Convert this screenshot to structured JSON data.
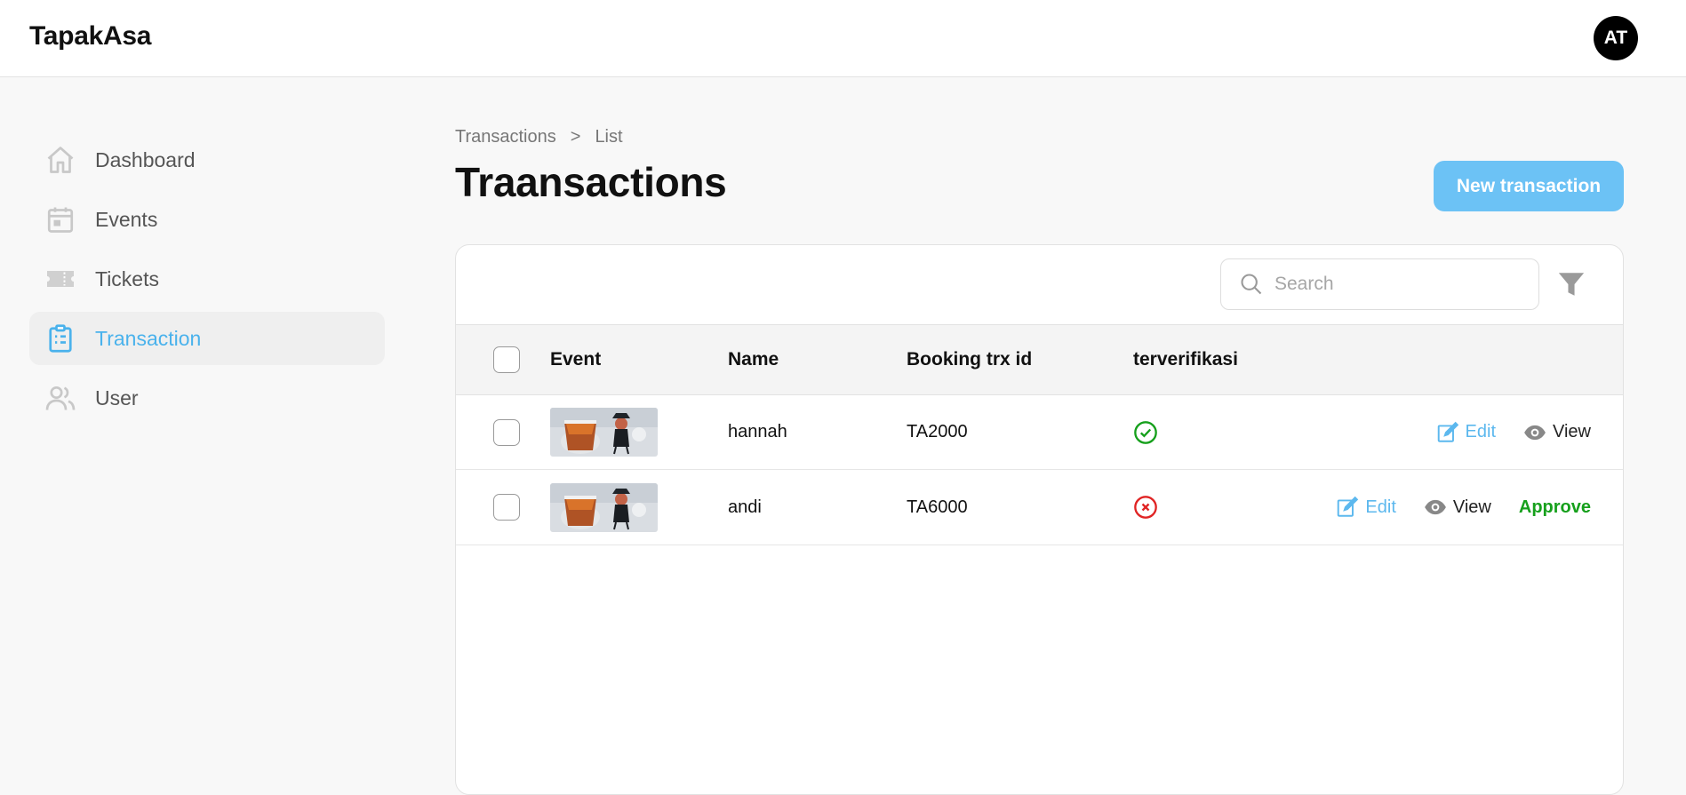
{
  "app": {
    "brand": "TapakAsa",
    "avatar_initials": "AT"
  },
  "sidebar": {
    "items": [
      {
        "label": "Dashboard",
        "icon": "home-icon"
      },
      {
        "label": "Events",
        "icon": "calendar-icon"
      },
      {
        "label": "Tickets",
        "icon": "ticket-icon"
      },
      {
        "label": "Transaction",
        "icon": "clipboard-list-icon",
        "active": true
      },
      {
        "label": "User",
        "icon": "users-icon"
      }
    ]
  },
  "breadcrumb": {
    "items": [
      "Transactions",
      "List"
    ],
    "separator": ">"
  },
  "page": {
    "title": "Traansactions",
    "new_button": "New transaction"
  },
  "toolbar": {
    "search_placeholder": "Search",
    "search_value": ""
  },
  "table": {
    "columns": [
      "Event",
      "Name",
      "Booking trx id",
      "terverifikasi"
    ],
    "rows": [
      {
        "event_image": "tea-figurine-thumbnail",
        "name": "hannah",
        "booking_trx_id": "TA2000",
        "verified": true,
        "actions": [
          "Edit",
          "View"
        ]
      },
      {
        "event_image": "tea-figurine-thumbnail",
        "name": "andi",
        "booking_trx_id": "TA6000",
        "verified": false,
        "actions": [
          "Edit",
          "View",
          "Approve"
        ]
      }
    ]
  },
  "colors": {
    "accent": "#4ab2ec",
    "button": "#6cc2f5",
    "verified": "#16a01c",
    "rejected": "#e02424",
    "approve": "#16a01c"
  }
}
